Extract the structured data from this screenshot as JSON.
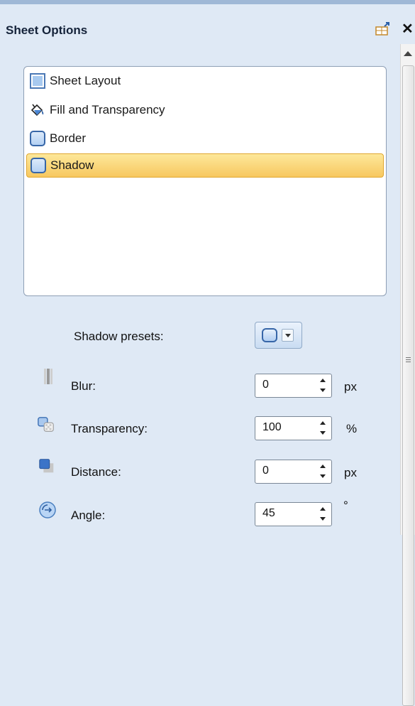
{
  "panel": {
    "title": "Sheet Options",
    "header_icons": [
      "pin-icon",
      "close-icon"
    ],
    "close_glyph": "✕"
  },
  "list": {
    "items": [
      {
        "label": "Sheet Layout",
        "icon": "sheet-layout-icon",
        "selected": false
      },
      {
        "label": "Fill and Transparency",
        "icon": "paint-bucket-icon",
        "selected": false
      },
      {
        "label": "Border",
        "icon": "border-icon",
        "selected": false
      },
      {
        "label": "Shadow",
        "icon": "shadow-icon",
        "selected": true
      }
    ]
  },
  "shadow": {
    "presets_label": "Shadow presets:",
    "blur": {
      "label": "Blur:",
      "value": "0",
      "unit": "px",
      "icon": "blur-icon"
    },
    "transparency": {
      "label": "Transparency:",
      "value": "100",
      "unit": "%",
      "icon": "transparency-icon"
    },
    "distance": {
      "label": "Distance:",
      "value": "0",
      "unit": "px",
      "icon": "distance-icon"
    },
    "angle": {
      "label": "Angle:",
      "value": "45",
      "unit": "°",
      "icon": "angle-icon"
    }
  },
  "colors": {
    "selection": "#f7c860",
    "panel_bg": "#dfe9f5",
    "accent": "#3766a8"
  }
}
